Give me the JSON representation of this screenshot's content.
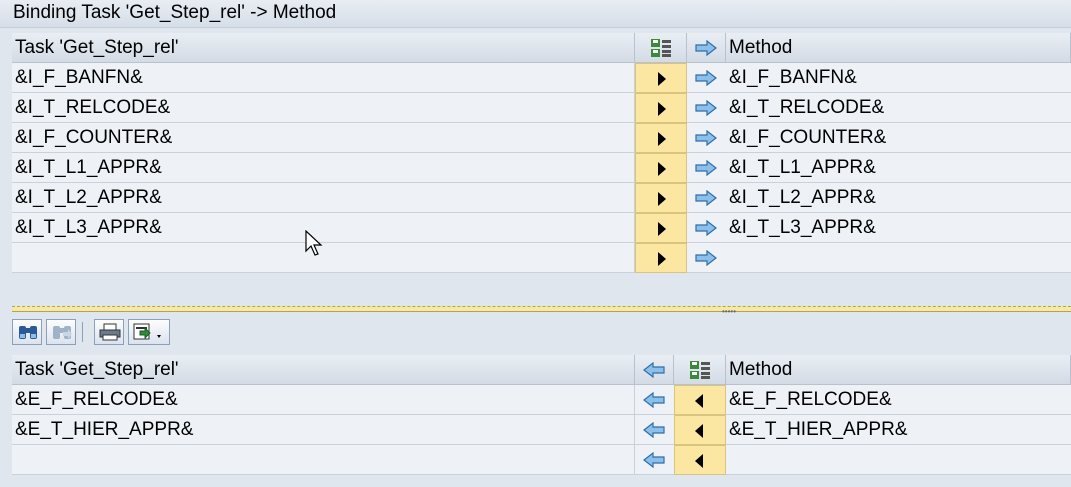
{
  "window": {
    "title": "Binding Task 'Get_Step_rel' -> Method"
  },
  "upper": {
    "header": {
      "task_col": "Task 'Get_Step_rel'",
      "method_col": "Method",
      "mid_icon": "floppy-grid-icon",
      "arrow_icon": "arrow-right-icon"
    },
    "rows": [
      {
        "task": "&I_F_BANFN&",
        "method": "&I_F_BANFN&"
      },
      {
        "task": "&I_T_RELCODE&",
        "method": "&I_T_RELCODE&"
      },
      {
        "task": "&I_F_COUNTER&",
        "method": "&I_F_COUNTER&"
      },
      {
        "task": "&I_T_L1_APPR&",
        "method": "&I_T_L1_APPR&"
      },
      {
        "task": "&I_T_L2_APPR&",
        "method": "&I_T_L2_APPR&"
      },
      {
        "task": "&I_T_L3_APPR&",
        "method": "&I_T_L3_APPR&"
      },
      {
        "task": "",
        "method": ""
      }
    ]
  },
  "toolbar": {
    "buttons": [
      "binoculars-icon",
      "binoculars-next-icon",
      "printer-icon",
      "export-icon"
    ]
  },
  "lower": {
    "header": {
      "task_col": "Task 'Get_Step_rel'",
      "method_col": "Method",
      "arrow_icon": "arrow-left-icon",
      "mid_icon": "floppy-grid-icon"
    },
    "rows": [
      {
        "task": "&E_F_RELCODE&",
        "method": "&E_F_RELCODE&"
      },
      {
        "task": "&E_T_HIER_APPR&",
        "method": "&E_T_HIER_APPR&"
      },
      {
        "task": "",
        "method": ""
      }
    ]
  },
  "colors": {
    "button_yellow": "#fbe6a2",
    "arrow_blue": "#5b9bd5",
    "background": "#dfe6ee"
  }
}
